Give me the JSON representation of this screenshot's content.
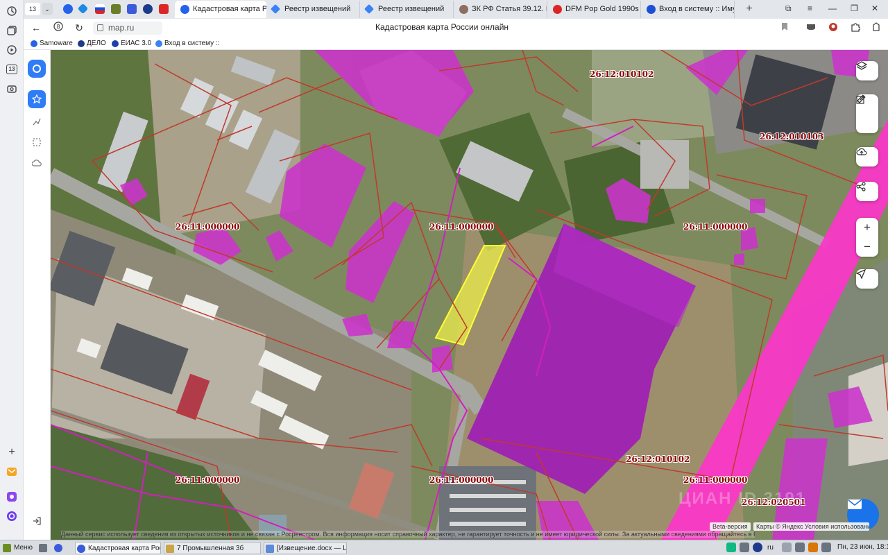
{
  "browser": {
    "tab_count": "13",
    "tabs": [
      {
        "title": "Кадастровая карта Р",
        "active": true
      },
      {
        "title": "Реестр извещений"
      },
      {
        "title": "Реестр извещений"
      },
      {
        "title": "ЗК РФ Статья 39.12. Про"
      },
      {
        "title": "DFM Pop Gold 1990s — с"
      },
      {
        "title": "Вход в систему :: Имущ"
      }
    ],
    "url": "map.ru",
    "page_title": "Кадастровая карта России онлайн",
    "bookmarks": [
      {
        "label": "Samoware"
      },
      {
        "label": "ДЕЛО"
      },
      {
        "label": "ЕИАС 3.0"
      },
      {
        "label": "Вход в систему ::"
      }
    ],
    "left_sidebar_badge": "13"
  },
  "map": {
    "cadastral_labels": [
      "26:12:010102",
      "26:12:010103",
      "26:11:000000",
      "26:11:000000",
      "26:11:000000",
      "26:12:010102",
      "26:11:000000",
      "26:11:000000",
      "26:11:000000",
      "26:12:020501"
    ],
    "watermark": "ЦИАН  ID 3191",
    "beta_label": "Beta-версия",
    "attribution": "Карты © Яндекс  Условия использования",
    "disclaimer": "Данный сервис использует сведения из открытых источников и не связан с Росреестром. Вся информация носит справочный характер, не гарантирует точность и не имеет юридической силы. За актуальными сведениями обращайтесь в Росреестр",
    "colors": {
      "parcel_border": "#c0392b",
      "building_fill": "#cc33cc",
      "selected_parcel": "#e6e64d",
      "road_parcel": "#ff33cc"
    }
  },
  "taskbar": {
    "menu_label": "Меню",
    "windows": [
      {
        "title": "Кадастровая карта Рос..."
      },
      {
        "title": "7 Промышленная 3б"
      },
      {
        "title": "[Извещение.docx — Li..."
      }
    ],
    "keyboard_layout": "ru",
    "clock": "Пн, 23 июн, 18:13"
  }
}
